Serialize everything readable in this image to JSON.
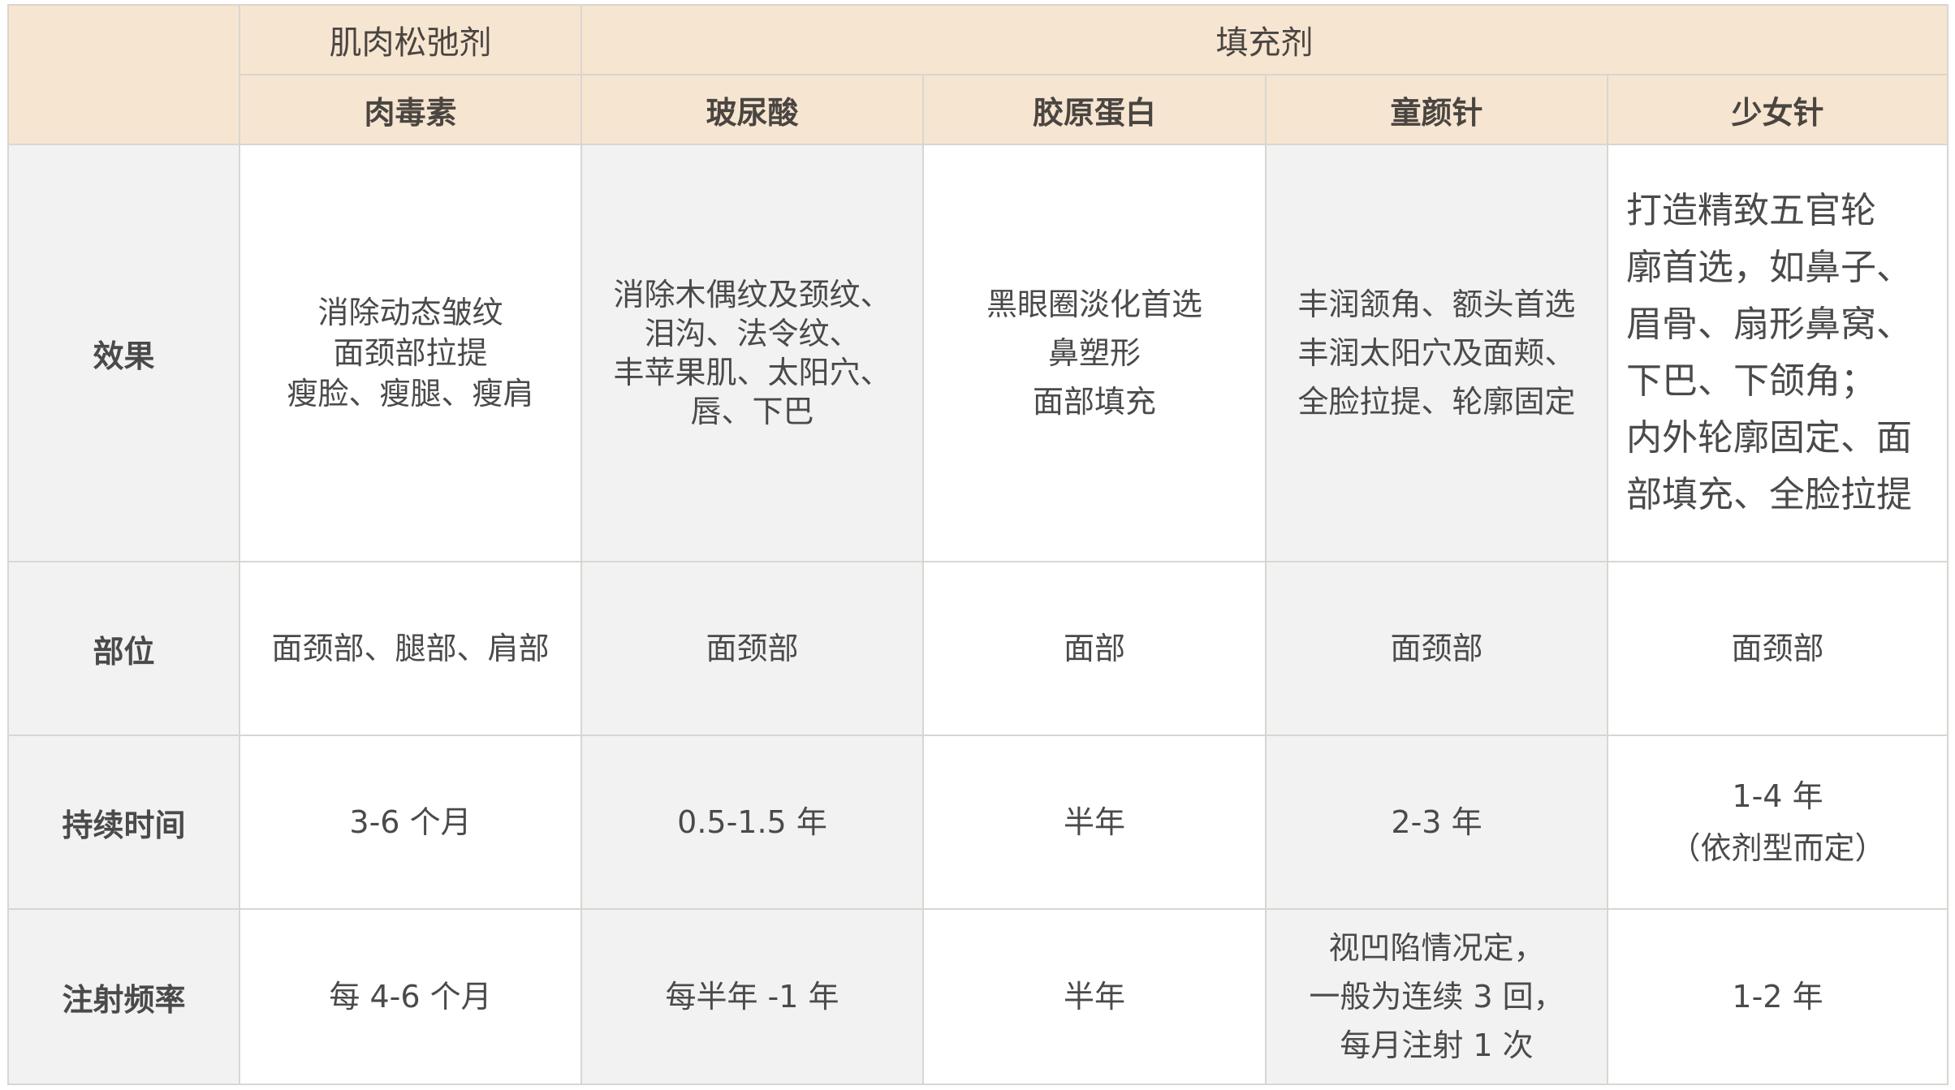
{
  "header": {
    "groups": [
      "肌肉松弛剂",
      "填充剂"
    ],
    "products": [
      "肉毒素",
      "玻尿酸",
      "胶原蛋白",
      "童颜针",
      "少女针"
    ]
  },
  "rows": {
    "effect": {
      "label": "效果",
      "cells": [
        [
          "消除动态皱纹",
          "面颈部拉提",
          "瘦脸、瘦腿、瘦肩"
        ],
        [
          "消除木偶纹及颈纹、",
          "泪沟、法令纹、",
          "丰苹果肌、太阳穴、",
          "唇、下巴"
        ],
        [
          "黑眼圈淡化首选",
          "鼻塑形",
          "面部填充"
        ],
        [
          "丰润颔角、额头首选",
          "丰润太阳穴及面颊、",
          "全脸拉提、轮廓固定"
        ],
        [
          "打造精致五官轮",
          "廓首选，如鼻子、",
          "眉骨、扇形鼻窝、",
          "下巴、下颌角；",
          "内外轮廓固定、面",
          "部填充、全脸拉提"
        ]
      ]
    },
    "part": {
      "label": "部位",
      "cells": [
        "面颈部、腿部、肩部",
        "面颈部",
        "面部",
        "面颈部",
        "面颈部"
      ]
    },
    "duration": {
      "label": "持续时间",
      "cells": [
        [
          "3-6 个月"
        ],
        [
          "0.5-1.5 年"
        ],
        [
          "半年"
        ],
        [
          "2-3 年"
        ],
        [
          "1-4 年",
          "（依剂型而定）"
        ]
      ]
    },
    "frequency": {
      "label": "注射频率",
      "cells": [
        [
          "每 4-6 个月"
        ],
        [
          "每半年 -1 年"
        ],
        [
          "半年"
        ],
        [
          "视凹陷情况定，",
          "一般为连续 3 回，",
          "每月注射 1 次"
        ],
        [
          "1-2 年"
        ]
      ]
    }
  },
  "colors": {
    "header_bg": "#f6e5d1",
    "grey_bg": "#f2f2f2",
    "border": "#d9d6d1",
    "text": "#4a4a4a"
  }
}
